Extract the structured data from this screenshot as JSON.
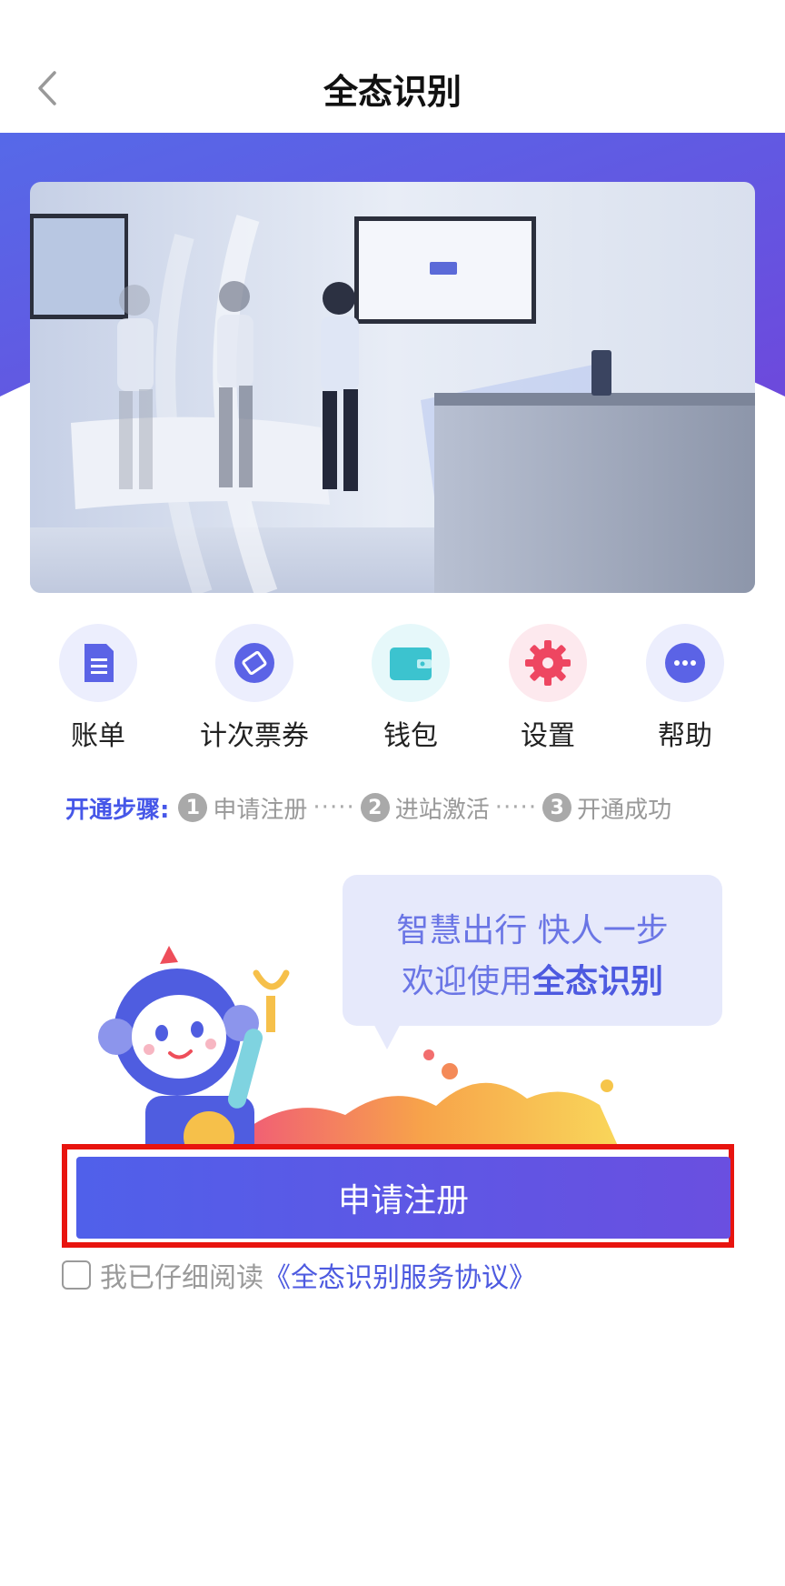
{
  "nav": {
    "title": "全态识别"
  },
  "quick_actions": [
    {
      "label": "账单",
      "icon": "document-icon",
      "color": "#5b63e6",
      "bg": "#eceefd"
    },
    {
      "label": "计次票券",
      "icon": "ticket-icon",
      "color": "#5b63e6",
      "bg": "#eceefd"
    },
    {
      "label": "钱包",
      "icon": "wallet-icon",
      "color": "#3cc3cf",
      "bg": "#e6f8fa"
    },
    {
      "label": "设置",
      "icon": "gear-icon",
      "color": "#ee4661",
      "bg": "#fde9ee"
    },
    {
      "label": "帮助",
      "icon": "more-icon",
      "color": "#5b63e6",
      "bg": "#eceefd"
    }
  ],
  "steps": {
    "lead": "开通步骤:",
    "items": [
      {
        "num": "1",
        "label": "申请注册"
      },
      {
        "num": "2",
        "label": "进站激活"
      },
      {
        "num": "3",
        "label": "开通成功"
      }
    ],
    "separator": "·····"
  },
  "bubble": {
    "line1": "智慧出行 快人一步",
    "line2_prefix": "欢迎使用",
    "line2_bold": "全态识别"
  },
  "cta": {
    "label": "申请注册"
  },
  "agreement": {
    "prefix": "我已仔细阅读",
    "link": "《全态识别服务协议》"
  },
  "colors": {
    "brand": "#5060ea",
    "highlight": "#e8140f"
  }
}
